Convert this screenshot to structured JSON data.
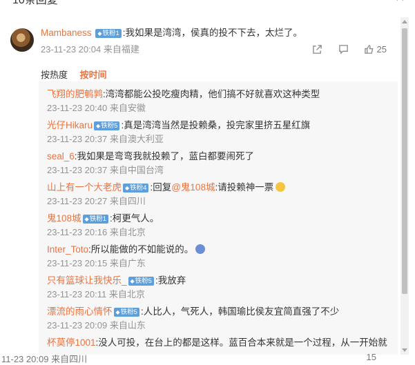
{
  "header": {
    "title": "10条回复",
    "close_icon": "close-icon"
  },
  "main_comment": {
    "user": "Mambaness",
    "badge": "铁粉1",
    "text": ":我如果是湾湾，侯真的投不下去，太烂了。",
    "time": "23-11-23 20:04",
    "location": "来自福建",
    "likes": "25"
  },
  "sort": {
    "hot": "按热度",
    "time": "按时间"
  },
  "replies": [
    {
      "user": "飞翔的肥鹌鹑",
      "badge": "",
      "text": ":湾湾都能公投吃瘦肉精，他们搞不好就喜欢这种类型",
      "time": "23-11-23 20:40",
      "location": "来自安徽"
    },
    {
      "user": "光仔Hikaru",
      "badge": "铁粉5",
      "text": ":真是湾湾当然是投赖桑，投完家里挤五星红旗",
      "time": "23-11-23 20:37",
      "location": "来自澳大利亚"
    },
    {
      "user": "seal_6",
      "badge": "",
      "text": ":我如果是弯弯我就投赖了，蓝白都要闹死了",
      "time": "23-11-23 20:37",
      "location": "来自中国台湾"
    },
    {
      "user": "山上有一个大老虎",
      "badge": "铁粉4",
      "text_before": ":回复",
      "mention": "@鬼108城",
      "text": ":请投赖神一票",
      "emoji": "cat-emoji",
      "time": "23-11-23 20:27",
      "location": "来自四川"
    },
    {
      "user": "鬼108城",
      "badge": "铁粉1",
      "text": ":柯更气人。",
      "time": "23-11-23 20:16",
      "location": "来自北京"
    },
    {
      "user": "Inter_Toto",
      "badge": "",
      "text": ":所以能做的不如能说的。",
      "emoji": "sob-emoji",
      "time": "23-11-23 20:15",
      "location": "来自广东"
    },
    {
      "user": "只有篮球让我快乐_",
      "badge": "铁粉5",
      "text": ":我放弃",
      "time": "23-11-23 20:11",
      "location": "来自北京"
    },
    {
      "user": "漂流的雨心情怀",
      "badge": "铁粉5",
      "text": ":人比人，气死人，韩国瑜比侯友宜简直强了不少",
      "time": "23-11-23 20:09",
      "location": "来自山东"
    },
    {
      "user": "杯莫停1001",
      "badge": "",
      "text": ":没人可投，在台上的都是这样。蓝百合本来就是一个过程，从一开始就",
      "time": "",
      "location": ""
    }
  ],
  "footer": {
    "time": "11-23 20:09",
    "location": "来自四川",
    "right_count": "15"
  },
  "colors": {
    "username": "#eb7340",
    "badge_bg": "#5f9fd9",
    "meta": "#939393",
    "replies_bg": "#f7f7f7"
  }
}
